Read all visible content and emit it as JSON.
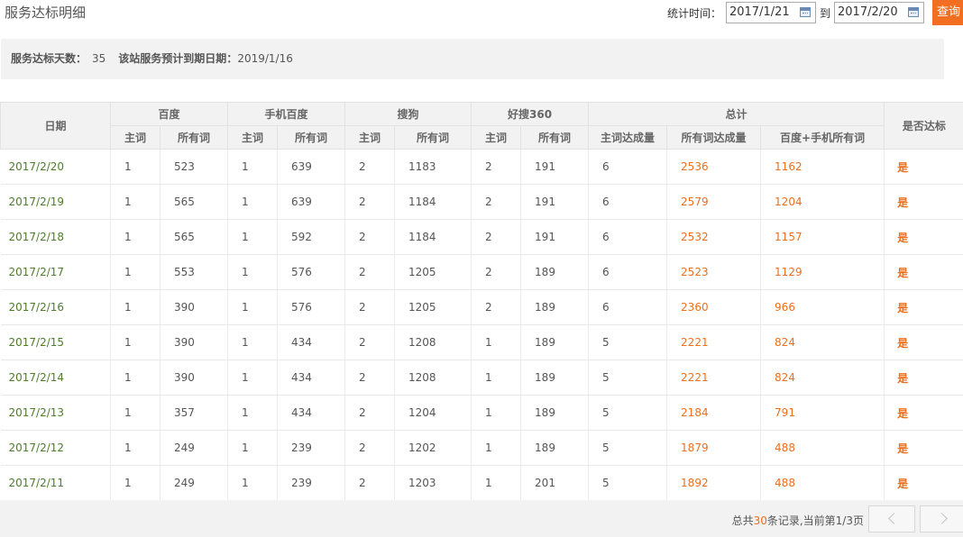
{
  "page": {
    "title": "服务达标明细"
  },
  "filter": {
    "label": "统计时间：",
    "start": "2017/1/21",
    "to_label": "到",
    "end": "2017/2/20",
    "query_label": "查询"
  },
  "summary": {
    "days_label": "服务达标天数：",
    "days_value": "35",
    "expiry_label": "该站服务预计到期日期：",
    "expiry_value": "2019/1/16"
  },
  "table": {
    "groups": {
      "date": "日期",
      "baidu": "百度",
      "mobile_baidu": "手机百度",
      "sogou": "搜狗",
      "haosou": "好搜360",
      "total": "总计",
      "pass": "是否达标"
    },
    "sub": {
      "main": "主词",
      "all": "所有词",
      "main_reached": "主词达成量",
      "all_reached": "所有词达成量",
      "baidu_plus_mobile": "百度+手机所有词"
    },
    "rows": [
      {
        "date": "2017/2/20",
        "baidu_main": "1",
        "baidu_all": "523",
        "mobile_main": "1",
        "mobile_all": "639",
        "sogou_main": "2",
        "sogou_all": "1183",
        "haosou_main": "2",
        "haosou_all": "191",
        "main_reached": "6",
        "all_reached": "2536",
        "baidu_mobile_all": "1162",
        "pass": "是"
      },
      {
        "date": "2017/2/19",
        "baidu_main": "1",
        "baidu_all": "565",
        "mobile_main": "1",
        "mobile_all": "639",
        "sogou_main": "2",
        "sogou_all": "1184",
        "haosou_main": "2",
        "haosou_all": "191",
        "main_reached": "6",
        "all_reached": "2579",
        "baidu_mobile_all": "1204",
        "pass": "是"
      },
      {
        "date": "2017/2/18",
        "baidu_main": "1",
        "baidu_all": "565",
        "mobile_main": "1",
        "mobile_all": "592",
        "sogou_main": "2",
        "sogou_all": "1184",
        "haosou_main": "2",
        "haosou_all": "191",
        "main_reached": "6",
        "all_reached": "2532",
        "baidu_mobile_all": "1157",
        "pass": "是"
      },
      {
        "date": "2017/2/17",
        "baidu_main": "1",
        "baidu_all": "553",
        "mobile_main": "1",
        "mobile_all": "576",
        "sogou_main": "2",
        "sogou_all": "1205",
        "haosou_main": "2",
        "haosou_all": "189",
        "main_reached": "6",
        "all_reached": "2523",
        "baidu_mobile_all": "1129",
        "pass": "是"
      },
      {
        "date": "2017/2/16",
        "baidu_main": "1",
        "baidu_all": "390",
        "mobile_main": "1",
        "mobile_all": "576",
        "sogou_main": "2",
        "sogou_all": "1205",
        "haosou_main": "2",
        "haosou_all": "189",
        "main_reached": "6",
        "all_reached": "2360",
        "baidu_mobile_all": "966",
        "pass": "是"
      },
      {
        "date": "2017/2/15",
        "baidu_main": "1",
        "baidu_all": "390",
        "mobile_main": "1",
        "mobile_all": "434",
        "sogou_main": "2",
        "sogou_all": "1208",
        "haosou_main": "1",
        "haosou_all": "189",
        "main_reached": "5",
        "all_reached": "2221",
        "baidu_mobile_all": "824",
        "pass": "是"
      },
      {
        "date": "2017/2/14",
        "baidu_main": "1",
        "baidu_all": "390",
        "mobile_main": "1",
        "mobile_all": "434",
        "sogou_main": "2",
        "sogou_all": "1208",
        "haosou_main": "1",
        "haosou_all": "189",
        "main_reached": "5",
        "all_reached": "2221",
        "baidu_mobile_all": "824",
        "pass": "是"
      },
      {
        "date": "2017/2/13",
        "baidu_main": "1",
        "baidu_all": "357",
        "mobile_main": "1",
        "mobile_all": "434",
        "sogou_main": "2",
        "sogou_all": "1204",
        "haosou_main": "1",
        "haosou_all": "189",
        "main_reached": "5",
        "all_reached": "2184",
        "baidu_mobile_all": "791",
        "pass": "是"
      },
      {
        "date": "2017/2/12",
        "baidu_main": "1",
        "baidu_all": "249",
        "mobile_main": "1",
        "mobile_all": "239",
        "sogou_main": "2",
        "sogou_all": "1202",
        "haosou_main": "1",
        "haosou_all": "189",
        "main_reached": "5",
        "all_reached": "1879",
        "baidu_mobile_all": "488",
        "pass": "是"
      },
      {
        "date": "2017/2/11",
        "baidu_main": "1",
        "baidu_all": "249",
        "mobile_main": "1",
        "mobile_all": "239",
        "sogou_main": "2",
        "sogou_all": "1203",
        "haosou_main": "1",
        "haosou_all": "201",
        "main_reached": "5",
        "all_reached": "1892",
        "baidu_mobile_all": "488",
        "pass": "是"
      }
    ]
  },
  "pager": {
    "prefix": "总共",
    "total": "30",
    "suffix": "条记录,当前第1/3页"
  },
  "colors": {
    "accent": "#f26f21",
    "highlight": "#ec6f1e",
    "date": "#4d7c2a"
  }
}
